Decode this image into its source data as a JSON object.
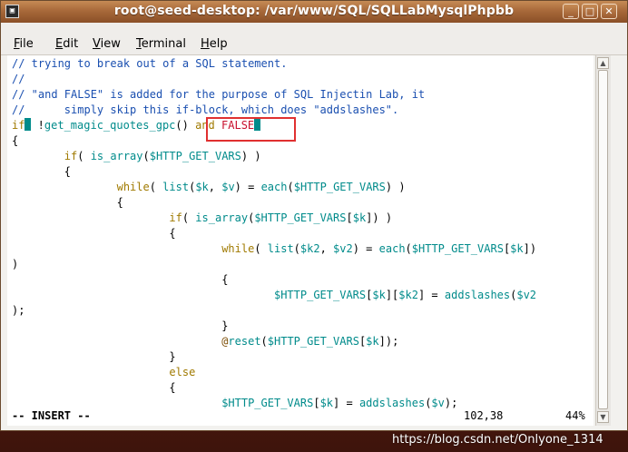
{
  "window": {
    "title": "root@seed-desktop: /var/www/SQL/SQLLabMysqlPhpbb",
    "icon_name": "terminal-icon",
    "controls": {
      "minimize": "_",
      "maximize": "□",
      "close": "✕"
    }
  },
  "menu": {
    "items": [
      {
        "first": "F",
        "rest": "ile"
      },
      {
        "first": "E",
        "rest": "dit"
      },
      {
        "first": "V",
        "rest": "iew"
      },
      {
        "first": "T",
        "rest": "erminal"
      },
      {
        "first": "H",
        "rest": "elp"
      }
    ]
  },
  "code": {
    "l1": "// trying to break out of a SQL statement.",
    "l2": "//",
    "l3": "// \"and FALSE\" is added for the purpose of SQL Injectin Lab, it",
    "l4": "//      simply skip this if-block, which does \"addslashes\".",
    "l5a": "if",
    "l5b": " !",
    "l5c": "get_magic_quotes_gpc",
    "l5d": "() ",
    "l5e": "and",
    "l5f": " ",
    "l5g": "FALSE",
    "l6": "{",
    "l7a": "        if",
    "l7b": "( ",
    "l7c": "is_array",
    "l7d": "(",
    "l7e": "$HTTP_GET_VARS",
    "l7f": ") )",
    "l8": "        {",
    "l9a": "                while",
    "l9b": "( ",
    "l9c": "list",
    "l9d": "(",
    "l9e": "$k",
    "l9f": ", ",
    "l9g": "$v",
    "l9h": ") = ",
    "l9i": "each",
    "l9j": "(",
    "l9k": "$HTTP_GET_VARS",
    "l9l": ") )",
    "l10": "                {",
    "l11a": "                        if",
    "l11b": "( ",
    "l11c": "is_array",
    "l11d": "(",
    "l11e": "$HTTP_GET_VARS",
    "l11f": "[",
    "l11g": "$k",
    "l11h": "]) )",
    "l12": "                        {",
    "l13a": "                                while",
    "l13b": "( ",
    "l13c": "list",
    "l13d": "(",
    "l13e": "$k2",
    "l13f": ", ",
    "l13g": "$v2",
    "l13h": ") = ",
    "l13i": "each",
    "l13j": "(",
    "l13k": "$HTTP_GET_VARS",
    "l13l": "[",
    "l13m": "$k",
    "l13n": "])",
    "l14": ")",
    "l15": "                                {",
    "l16a": "                                        ",
    "l16b": "$HTTP_GET_VARS",
    "l16c": "[",
    "l16d": "$k",
    "l16e": "][",
    "l16f": "$k2",
    "l16g": "] = ",
    "l16h": "addslashes",
    "l16i": "(",
    "l16j": "$v2",
    "l17": ");",
    "l18": "                                }",
    "l19a": "                                @",
    "l19b": "reset",
    "l19c": "(",
    "l19d": "$HTTP_GET_VARS",
    "l19e": "[",
    "l19f": "$k",
    "l19g": "]);",
    "l20": "                        }",
    "l21": "                        else",
    "l22": "                        {",
    "l23a": "                                ",
    "l23b": "$HTTP_GET_VARS",
    "l23c": "[",
    "l23d": "$k",
    "l23e": "] = ",
    "l23f": "addslashes",
    "l23g": "(",
    "l23h": "$v",
    "l23i": ");"
  },
  "status": {
    "mode": "-- INSERT --",
    "position": "102,38",
    "percent": "44%"
  },
  "scrollbar": {
    "up": "▲",
    "down": "▼"
  },
  "watermark": "https://blog.csdn.net/Onlyone_1314"
}
